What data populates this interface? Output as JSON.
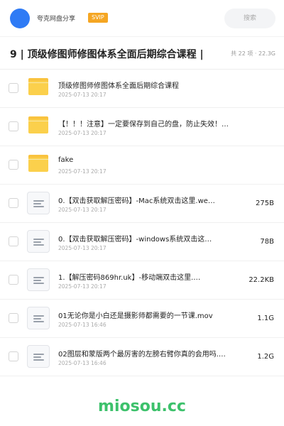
{
  "header": {
    "app_name": "夸克网盘分享",
    "badge": "SVIP",
    "search_placeholder": "搜索"
  },
  "title": "9 | 顶级修图师修图体系全面后期综合课程 |",
  "meta": "共 22 项 · 22.3G",
  "items": [
    {
      "type": "folder",
      "name": "顶级修图师修图体系全面后期综合课程",
      "date": "2025-07-13 20:17",
      "size": ""
    },
    {
      "type": "folder",
      "name": "【！！！注意】一定要保存到自己的盘，防止失效！！！",
      "date": "2025-07-13 20:17",
      "size": ""
    },
    {
      "type": "folder",
      "name": "fake",
      "date": "2025-07-13 20:17",
      "size": ""
    },
    {
      "type": "file",
      "name": "0.【双击获取解压密码】-Mac系统双击这里.we…",
      "date": "2025-07-13 20:17",
      "size": "275B"
    },
    {
      "type": "file",
      "name": "0.【双击获取解压密码】-windows系统双击这…",
      "date": "2025-07-13 20:17",
      "size": "78B"
    },
    {
      "type": "file",
      "name": "1.【解压密码869hr.uk】-移动端双击这里.…",
      "date": "2025-07-13 20:17",
      "size": "22.2KB"
    },
    {
      "type": "file",
      "name": "01无论你是小白还是摄影师都需要的一节课.mov",
      "date": "2025-07-13 16:46",
      "size": "1.1G"
    },
    {
      "type": "file",
      "name": "02图层和蒙版两个最厉害的左膀右臂你真的会用吗.m…",
      "date": "2025-07-13 16:46",
      "size": "1.2G"
    }
  ],
  "watermark": "miosou.cc",
  "colors": {
    "accent": "#2f7bf5",
    "svip": "#f5a623",
    "folder": "#fbd04c",
    "watermark": "#3cc16b"
  }
}
